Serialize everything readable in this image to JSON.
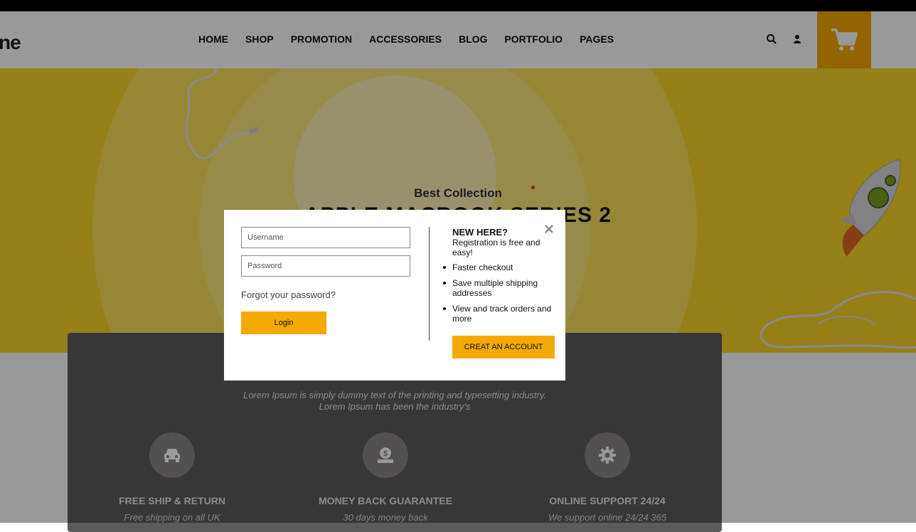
{
  "header": {
    "logo_text": "ne",
    "nav": [
      "HOME",
      "SHOP",
      "PROMOTION",
      "ACCESSORIES",
      "BLOG",
      "PORTFOLIO",
      "PAGES"
    ],
    "icons": [
      "search-icon",
      "user-icon",
      "cart-icon"
    ],
    "accent_color": "#f5a800"
  },
  "hero": {
    "subtitle": "Best Collection",
    "title": "APPLE MACBOOK SERIES 2",
    "background_color": "#f8d52a"
  },
  "features": {
    "description_line1": "Lorem Ipsum is simply dummy text of the printing and typesetting industry.",
    "description_line2": "Lorem Ipsum has been the industry's",
    "items": [
      {
        "icon": "car-icon",
        "title": "FREE SHIP & RETURN",
        "text": "Free shipping on all UK"
      },
      {
        "icon": "money-icon",
        "title": "MONEY BACK GUARANTEE",
        "text": "30 days money back"
      },
      {
        "icon": "gear-icon",
        "title": "ONLINE SUPPORT 24/24",
        "text": "We support online 24/24 365"
      }
    ]
  },
  "login_modal": {
    "username_placeholder": "Username",
    "password_placeholder": "Password",
    "forgot_password": "Forgot your password?",
    "login_button": "Login",
    "new_here_title": "NEW HERE?",
    "registration_text": "Registration is free and easy!",
    "benefits": [
      "Faster checkout",
      "Save multiple shipping addresses",
      "View and track orders and more"
    ],
    "create_account_button": "CREAT AN ACCOUNT"
  }
}
